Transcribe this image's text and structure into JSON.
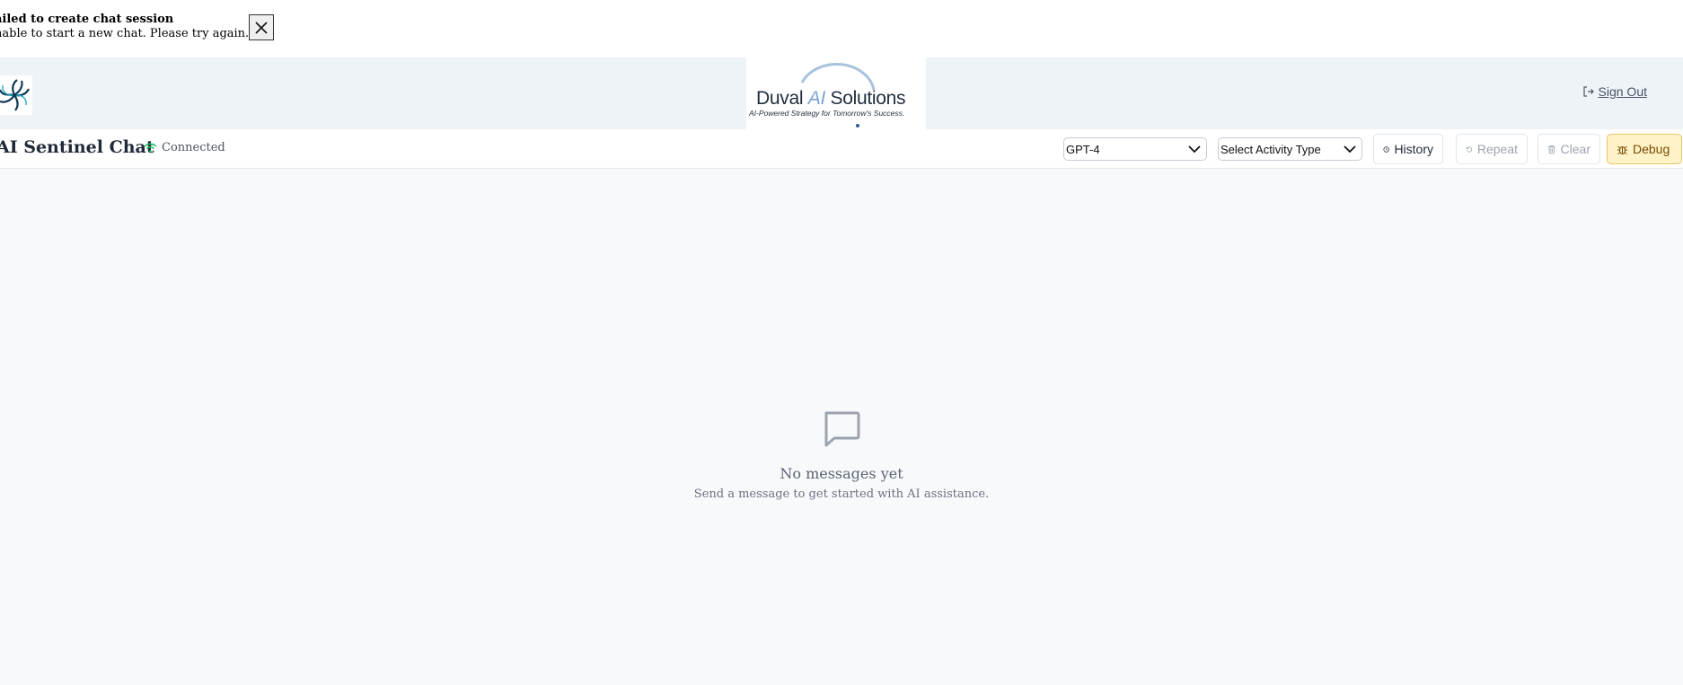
{
  "toast": {
    "title": "ailed to create chat session",
    "message": "nable to start a new chat. Please try again."
  },
  "header": {
    "brand_name_1": "Duval ",
    "brand_name_ai": "AI",
    "brand_name_2": " Solutions",
    "brand_tagline": "AI-Powered Strategy for Tomorrow's Success.",
    "sign_out": "Sign Out"
  },
  "chat": {
    "title": "AI Sentinel Chat",
    "status": "Connected",
    "model_select": "GPT-4",
    "activity_select": "Select Activity Type",
    "buttons": {
      "history": "History",
      "repeat": "Repeat",
      "clear": "Clear",
      "debug": "Debug"
    }
  },
  "empty": {
    "title": "No messages yet",
    "subtitle": "Send a message to get started with AI assistance."
  },
  "colors": {
    "accent_connected": "#22c55e",
    "debug_bg": "#fdf3c7",
    "header_bg": "#eef3f8"
  }
}
